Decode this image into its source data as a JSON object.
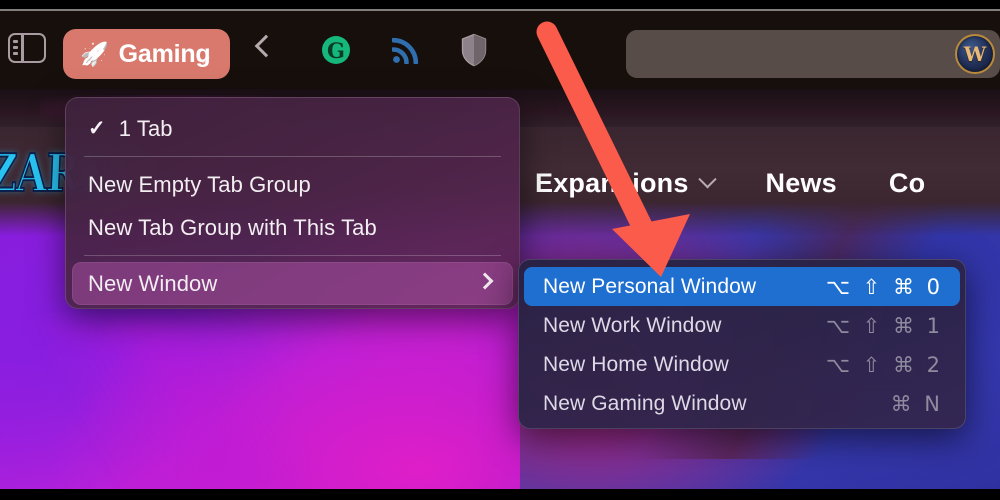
{
  "browser": {
    "sidebar_toggle": "sidebar-toggle",
    "tab_group": {
      "label": "Gaming",
      "icon": "rocket-icon",
      "color": "#d9796d"
    },
    "back_button": "back",
    "extensions": [
      {
        "name": "grammarly-icon",
        "label": "G",
        "color": "#15b87a"
      },
      {
        "name": "rss-feed-icon",
        "color": "#2f6fb0"
      },
      {
        "name": "shield-privacy-icon",
        "color": "#8d8289"
      }
    ],
    "address_bar": {
      "value": "",
      "placeholder": "",
      "favicon_label": "W",
      "favicon_name": "world-of-warcraft-favicon"
    }
  },
  "webpage": {
    "logo_text": "ZARD",
    "nav_links": [
      {
        "label": "Expansions",
        "has_caret": true
      },
      {
        "label": "News",
        "has_caret": false
      },
      {
        "label": "Co",
        "has_caret": false
      }
    ]
  },
  "menu": {
    "items": [
      {
        "label": "1 Tab",
        "checked": true,
        "type": "check"
      },
      {
        "type": "separator"
      },
      {
        "label": "New Empty Tab Group",
        "type": "item"
      },
      {
        "label": "New Tab Group with This Tab",
        "type": "item"
      },
      {
        "type": "separator"
      },
      {
        "label": "New Window",
        "type": "submenu",
        "selected": true,
        "arrow": "chevron-right-icon"
      }
    ],
    "check_glyph": "✓"
  },
  "submenu": {
    "items": [
      {
        "label": "New Personal Window",
        "shortcut": "⌥ ⇧ ⌘ 0",
        "selected": true
      },
      {
        "label": "New Work Window",
        "shortcut": "⌥ ⇧ ⌘ 1",
        "selected": false
      },
      {
        "label": "New Home Window",
        "shortcut": "⌥ ⇧ ⌘ 2",
        "selected": false
      },
      {
        "label": "New Gaming Window",
        "shortcut": "⌘ N",
        "selected": false
      }
    ],
    "highlight_color": "#1f6fd0"
  },
  "annotation": {
    "arrow_color": "#fb5b4a",
    "name": "red-arrow-annotation"
  }
}
